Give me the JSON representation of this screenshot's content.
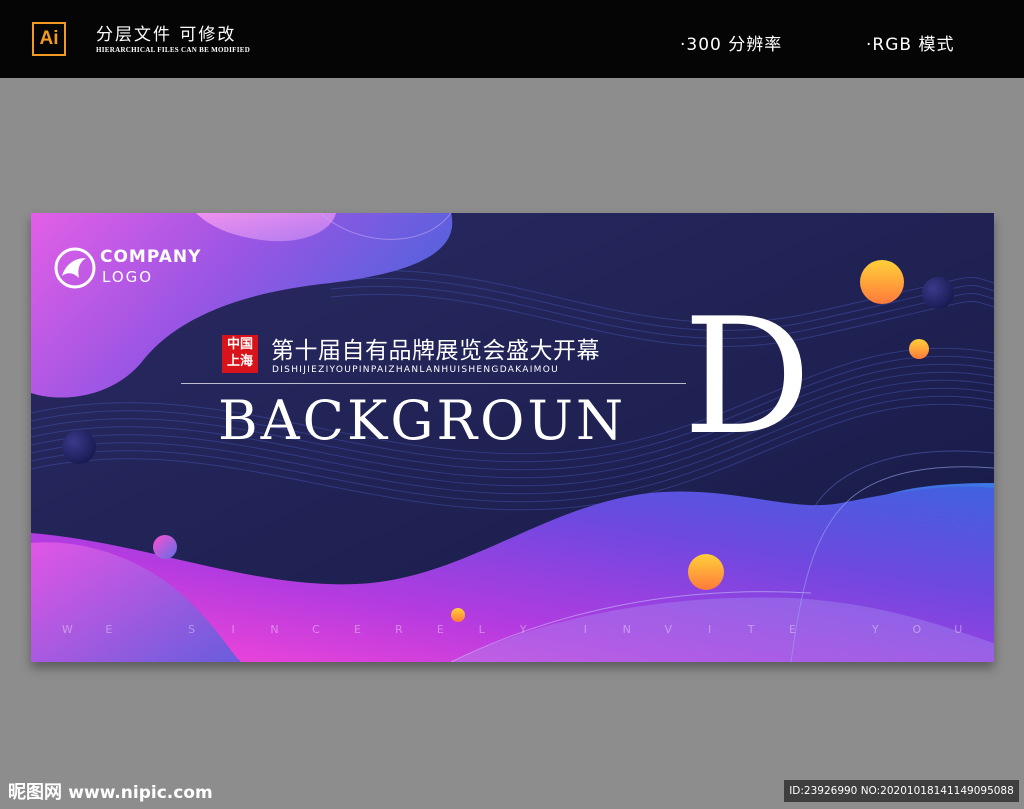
{
  "header": {
    "app_badge": "Ai",
    "title": "分层文件 可修改",
    "subtitle": "HIERARCHICAL FILES CAN BE MODIFIED",
    "spec_resolution": "·300 分辨率",
    "spec_color_mode": "·RGB 模式"
  },
  "banner": {
    "logo_company": "COMPANY",
    "logo_logo": "LOGO",
    "seal_line1": "中国",
    "seal_line2": "上海",
    "cn_title": "第十届自有品牌展览会盛大开幕",
    "pinyin": "DISHIJIEZIYOUPINPAIZHANLANHUISHENGDAKAIMOU",
    "main_word": "BACKGROUN",
    "big_letter": "D",
    "invite": "WE SINCERELY INVITE YOU",
    "colors": {
      "base": "#1e2152",
      "magenta": "#e84ee0",
      "violet": "#8a3fe0",
      "blue": "#3e6fe0",
      "orange": "#ffb43a"
    }
  },
  "footer": {
    "site_name": "昵图网",
    "site_url": "www.nipic.com",
    "image_id": "ID:23926990 NO:20201018141149095088"
  }
}
